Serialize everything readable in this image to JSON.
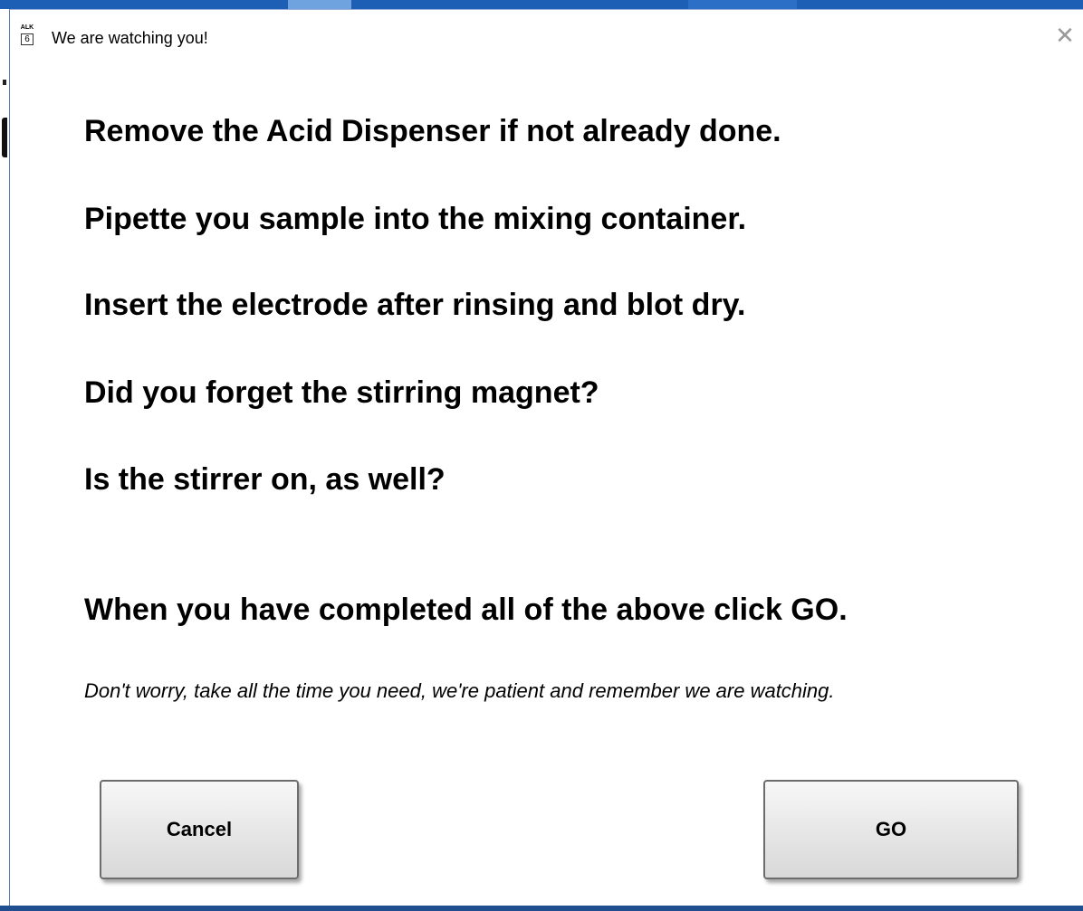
{
  "window": {
    "title": "We are watching you!",
    "icon": {
      "name": "alk-6-app-icon",
      "top_text": "ALK",
      "bottom_text": "6"
    },
    "close_glyph": "✕"
  },
  "instructions": [
    "Remove the Acid Dispenser if not already done.",
    "Pipette you sample into the mixing container.",
    "Insert the electrode after rinsing and blot dry.",
    "Did you forget the stirring magnet?",
    "Is the stirrer on, as well?"
  ],
  "final_instruction": "When you have completed all of the above click GO.",
  "note": "Don't worry, take all the time you need, we're patient and remember we are watching.",
  "buttons": {
    "cancel_label": "Cancel",
    "go_label": "GO"
  },
  "colors": {
    "desktop_blue": "#1c5fb4",
    "button_border": "#6c6c6c"
  }
}
